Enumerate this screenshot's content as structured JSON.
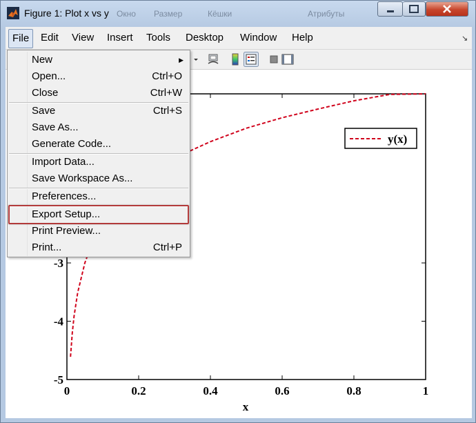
{
  "window": {
    "title": "Figure 1: Plot x vs y",
    "background_menu": [
      "Окно",
      "Размер",
      "Кёшки",
      "Атрибуты"
    ]
  },
  "menubar": {
    "items": [
      "File",
      "Edit",
      "View",
      "Insert",
      "Tools",
      "Desktop",
      "Window",
      "Help"
    ],
    "corner_glyph": "↘"
  },
  "file_menu": {
    "items": [
      {
        "label": "New",
        "shortcut": "",
        "submenu": true
      },
      {
        "label": "Open...",
        "shortcut": "Ctrl+O"
      },
      {
        "label": "Close",
        "shortcut": "Ctrl+W"
      },
      {
        "label": "Save",
        "shortcut": "Ctrl+S"
      },
      {
        "label": "Save As...",
        "shortcut": ""
      },
      {
        "label": "Generate Code...",
        "shortcut": ""
      },
      {
        "label": "Import Data...",
        "shortcut": ""
      },
      {
        "label": "Save Workspace As...",
        "shortcut": ""
      },
      {
        "label": "Preferences...",
        "shortcut": ""
      },
      {
        "label": "Export Setup...",
        "shortcut": "",
        "highlighted": true
      },
      {
        "label": "Print Preview...",
        "shortcut": ""
      },
      {
        "label": "Print...",
        "shortcut": "Ctrl+P"
      }
    ],
    "submenu_glyph": "▶"
  },
  "chart_data": {
    "type": "line",
    "xlabel": "x",
    "ylabel": "",
    "xlim": [
      0,
      1
    ],
    "ylim": [
      -5,
      -0.1
    ],
    "xticks": [
      "0",
      "0.2",
      "0.4",
      "0.6",
      "0.8",
      "1"
    ],
    "yticks": [
      "-3",
      "-4",
      "-5"
    ],
    "legend": {
      "entries": [
        "y(x)"
      ],
      "placement": "top-right"
    },
    "series": [
      {
        "name": "y(x)",
        "color": "#d0021b",
        "style": "dashed",
        "x": [
          0.01,
          0.015,
          0.02,
          0.03,
          0.05,
          0.07,
          0.1,
          0.15,
          0.2,
          0.3,
          0.4,
          0.5,
          0.6,
          0.7,
          0.8,
          0.9,
          1.0
        ],
        "y": [
          -4.61,
          -4.2,
          -3.91,
          -3.51,
          -3.0,
          -2.66,
          -2.3,
          -1.9,
          -1.61,
          -1.2,
          -0.92,
          -0.69,
          -0.51,
          -0.36,
          -0.22,
          -0.11,
          0.0
        ]
      }
    ]
  }
}
